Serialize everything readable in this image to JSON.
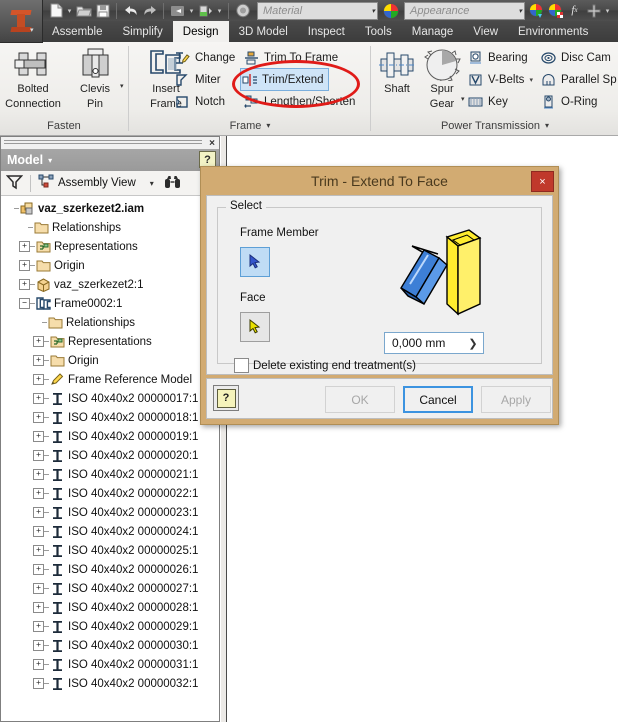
{
  "app": {
    "logo_name": "inventor-logo",
    "quick_access": [
      {
        "name": "new-file-icon",
        "glyph": "▢"
      },
      {
        "name": "open-file-icon",
        "glyph": "🗁"
      },
      {
        "name": "save-icon",
        "glyph": "💾"
      },
      {
        "name": "undo-icon",
        "glyph": "↩"
      },
      {
        "name": "redo-icon",
        "glyph": "↪"
      },
      {
        "name": "return-icon",
        "glyph": "↵"
      },
      {
        "name": "update-icon",
        "glyph": "▤"
      },
      {
        "name": "select-icon",
        "glyph": "◌"
      },
      {
        "name": "material-color-wheel-icon",
        "glyph": "●"
      },
      {
        "name": "appearance-adjust-icon",
        "glyph": "●"
      },
      {
        "name": "appearance-clear-icon",
        "glyph": "●"
      },
      {
        "name": "parameters-fx-icon",
        "glyph": "fx"
      },
      {
        "name": "customize-plus-icon",
        "glyph": "✚"
      },
      {
        "name": "qat-overflow-icon",
        "glyph": "▾"
      }
    ],
    "material_combo": {
      "value": "Material",
      "arrow": "▾"
    },
    "appearance_combo": {
      "value": "Appearance",
      "arrow": "▾"
    }
  },
  "ribbon": {
    "tabs": [
      {
        "label": "Assemble",
        "active": false
      },
      {
        "label": "Simplify",
        "active": false
      },
      {
        "label": "Design",
        "active": true
      },
      {
        "label": "3D Model",
        "active": false
      },
      {
        "label": "Inspect",
        "active": false
      },
      {
        "label": "Tools",
        "active": false
      },
      {
        "label": "Manage",
        "active": false
      },
      {
        "label": "View",
        "active": false
      },
      {
        "label": "Environments",
        "active": false
      }
    ],
    "panels": [
      {
        "name": "fasten",
        "label": "Fasten",
        "big_buttons": [
          {
            "label_line1": "Bolted",
            "label_line2": "Connection",
            "icon": "bolted-connection-icon"
          },
          {
            "label_line1": "Clevis",
            "label_line2": "Pin",
            "icon": "clevis-pin-icon",
            "has_dropdown": true
          }
        ]
      },
      {
        "name": "frame",
        "label": "Frame",
        "label_arrow": "▾",
        "big_buttons": [
          {
            "label_line1": "Insert",
            "label_line2": "Frame",
            "icon": "insert-frame-icon"
          }
        ],
        "small_buttons": [
          {
            "label": "Change",
            "icon": "change-icon",
            "selected": false
          },
          {
            "label": "Miter",
            "icon": "miter-icon",
            "selected": false
          },
          {
            "label": "Notch",
            "icon": "notch-icon",
            "selected": false
          },
          {
            "label": "Trim To Frame",
            "icon": "trim-to-frame-icon",
            "selected": false
          },
          {
            "label": "Trim/Extend",
            "icon": "trim-extend-icon",
            "selected": true
          },
          {
            "label": "Lengthen/Shorten",
            "icon": "lengthen-shorten-icon",
            "selected": false
          }
        ]
      },
      {
        "name": "power-transmission",
        "label": "Power Transmission",
        "label_arrow": "▾",
        "big_buttons": [
          {
            "label_line1": "Shaft",
            "label_line2": "",
            "icon": "shaft-icon"
          },
          {
            "label_line1": "Spur",
            "label_line2": "Gear",
            "icon": "spur-gear-icon",
            "has_dropdown": true
          }
        ],
        "small_buttons": [
          {
            "label": "Bearing",
            "icon": "bearing-icon"
          },
          {
            "label": "V-Belts",
            "icon": "v-belts-icon",
            "has_dropdown": true
          },
          {
            "label": "Key",
            "icon": "key-icon"
          },
          {
            "label": "Disc Cam",
            "icon": "disc-cam-icon"
          },
          {
            "label": "Parallel Sp",
            "icon": "parallel-splines-icon"
          },
          {
            "label": "O-Ring",
            "icon": "o-ring-icon"
          }
        ]
      }
    ]
  },
  "annotation": {
    "shape": "ellipse",
    "color": "#e01b18",
    "target": "Trim/Extend"
  },
  "browser": {
    "close_glyph": "×",
    "title": "Model",
    "title_caret": "▾",
    "help_glyph": "?",
    "toolbar": {
      "filter_icon": "filter-funnel-icon",
      "view_label": "Assembly View",
      "view_caret": "▾",
      "find_icon": "binoculars-icon"
    },
    "tree": [
      {
        "label": "vaz_szerkezet2.iam",
        "indent": 0,
        "expander": "",
        "icon": "assembly-icon",
        "bold": true
      },
      {
        "label": "Relationships",
        "indent": 1,
        "expander": "",
        "icon": "folder-icon",
        "bold": false
      },
      {
        "label": "Representations",
        "indent": 1,
        "expander": "+",
        "icon": "representations-icon",
        "bold": false
      },
      {
        "label": "Origin",
        "indent": 1,
        "expander": "+",
        "icon": "folder-icon",
        "bold": false
      },
      {
        "label": "vaz_szerkezet2:1",
        "indent": 1,
        "expander": "+",
        "icon": "part-cube-icon",
        "bold": false
      },
      {
        "label": "Frame0002:1",
        "indent": 1,
        "expander": "−",
        "icon": "frame-icon",
        "bold": false
      },
      {
        "label": "Relationships",
        "indent": 2,
        "expander": "",
        "icon": "folder-icon",
        "bold": false
      },
      {
        "label": "Representations",
        "indent": 2,
        "expander": "+",
        "icon": "representations-icon",
        "bold": false
      },
      {
        "label": "Origin",
        "indent": 2,
        "expander": "+",
        "icon": "folder-icon",
        "bold": false
      },
      {
        "label": "Frame Reference Model",
        "indent": 2,
        "expander": "+",
        "icon": "frame-reference-icon",
        "bold": false
      },
      {
        "label": "ISO 40x40x2 00000017:1",
        "indent": 2,
        "expander": "+",
        "icon": "beam-icon",
        "bold": false
      },
      {
        "label": "ISO 40x40x2 00000018:1",
        "indent": 2,
        "expander": "+",
        "icon": "beam-icon",
        "bold": false
      },
      {
        "label": "ISO 40x40x2 00000019:1",
        "indent": 2,
        "expander": "+",
        "icon": "beam-icon",
        "bold": false
      },
      {
        "label": "ISO 40x40x2 00000020:1",
        "indent": 2,
        "expander": "+",
        "icon": "beam-icon",
        "bold": false
      },
      {
        "label": "ISO 40x40x2 00000021:1",
        "indent": 2,
        "expander": "+",
        "icon": "beam-icon",
        "bold": false
      },
      {
        "label": "ISO 40x40x2 00000022:1",
        "indent": 2,
        "expander": "+",
        "icon": "beam-icon",
        "bold": false
      },
      {
        "label": "ISO 40x40x2 00000023:1",
        "indent": 2,
        "expander": "+",
        "icon": "beam-icon",
        "bold": false
      },
      {
        "label": "ISO 40x40x2 00000024:1",
        "indent": 2,
        "expander": "+",
        "icon": "beam-icon",
        "bold": false
      },
      {
        "label": "ISO 40x40x2 00000025:1",
        "indent": 2,
        "expander": "+",
        "icon": "beam-icon",
        "bold": false
      },
      {
        "label": "ISO 40x40x2 00000026:1",
        "indent": 2,
        "expander": "+",
        "icon": "beam-icon",
        "bold": false
      },
      {
        "label": "ISO 40x40x2 00000027:1",
        "indent": 2,
        "expander": "+",
        "icon": "beam-icon",
        "bold": false
      },
      {
        "label": "ISO 40x40x2 00000028:1",
        "indent": 2,
        "expander": "+",
        "icon": "beam-icon",
        "bold": false
      },
      {
        "label": "ISO 40x40x2 00000029:1",
        "indent": 2,
        "expander": "+",
        "icon": "beam-icon",
        "bold": false
      },
      {
        "label": "ISO 40x40x2 00000030:1",
        "indent": 2,
        "expander": "+",
        "icon": "beam-icon",
        "bold": false
      },
      {
        "label": "ISO 40x40x2 00000031:1",
        "indent": 2,
        "expander": "+",
        "icon": "beam-icon",
        "bold": false
      },
      {
        "label": "ISO 40x40x2 00000032:1",
        "indent": 2,
        "expander": "+",
        "icon": "beam-icon",
        "bold": false
      }
    ]
  },
  "dialog": {
    "title": "Trim - Extend To Face",
    "close_glyph": "×",
    "group_caption": "Select",
    "frame_member_label": "Frame Member",
    "frame_member_state": "active",
    "face_label": "Face",
    "face_state": "inactive",
    "offset_value": "0,000 mm",
    "offset_chevron": "❯",
    "checkbox_label": "Delete existing end treatment(s)",
    "checkbox_checked": false,
    "help_glyph": "?",
    "buttons": [
      {
        "label": "OK",
        "state": "disabled"
      },
      {
        "label": "Cancel",
        "state": "focused"
      },
      {
        "label": "Apply",
        "state": "disabled"
      }
    ],
    "preview": {
      "name": "trim-extend-preview-illustration",
      "colors": {
        "member": "#3d7fd6",
        "face": "#ffec2e",
        "outline": "#000000"
      }
    }
  },
  "colors": {
    "dialog_frame": "#d2ab72",
    "dialog_body": "#f0f0f0",
    "ribbon_bg": "#f1f0ee",
    "tab_strip": "#4a4a4a",
    "annotation_red": "#e01b18",
    "selection_blue": "#cfe4f7",
    "logo_orange": "#c44d24"
  }
}
